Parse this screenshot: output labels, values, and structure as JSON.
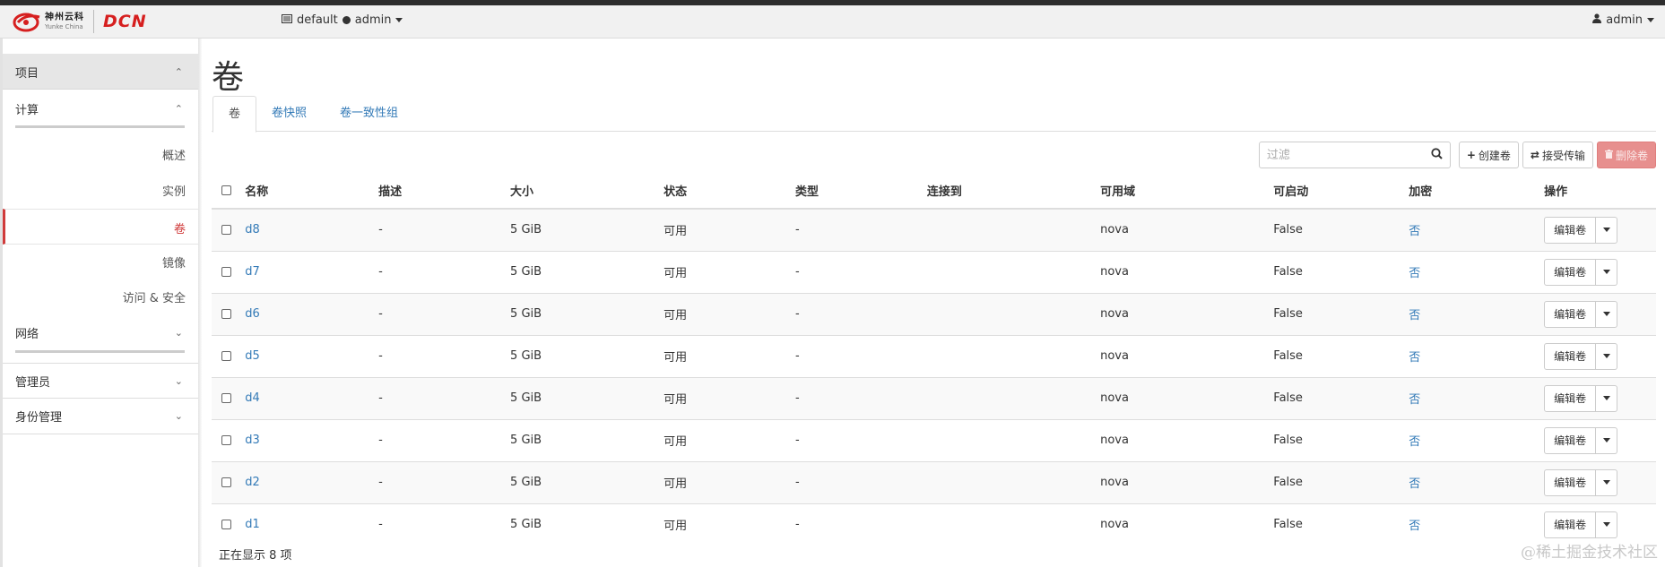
{
  "header": {
    "logo_cn": "神州云科",
    "logo_en": "Yunke China",
    "logo_brand": "DCN",
    "project": "default",
    "project_user": "admin",
    "user": "admin"
  },
  "sidebar": {
    "project": "项目",
    "compute": "计算",
    "compute_items": [
      "概述",
      "实例",
      "卷",
      "镜像",
      "访问 & 安全"
    ],
    "network": "网络",
    "admin": "管理员",
    "identity": "身份管理"
  },
  "main": {
    "title": "卷",
    "tabs": [
      "卷",
      "卷快照",
      "卷一致性组"
    ],
    "filter_placeholder": "过滤",
    "btn_create": "创建卷",
    "btn_transfer": "接受传输",
    "btn_delete": "删除卷",
    "columns": [
      "名称",
      "描述",
      "大小",
      "状态",
      "类型",
      "连接到",
      "可用域",
      "可启动",
      "加密",
      "操作"
    ],
    "rows": [
      {
        "name": "d8",
        "desc": "-",
        "size": "5 GiB",
        "status": "可用",
        "type": "-",
        "attached": "",
        "zone": "nova",
        "bootable": "False",
        "encrypted": "否",
        "action": "编辑卷"
      },
      {
        "name": "d7",
        "desc": "-",
        "size": "5 GiB",
        "status": "可用",
        "type": "-",
        "attached": "",
        "zone": "nova",
        "bootable": "False",
        "encrypted": "否",
        "action": "编辑卷"
      },
      {
        "name": "d6",
        "desc": "-",
        "size": "5 GiB",
        "status": "可用",
        "type": "-",
        "attached": "",
        "zone": "nova",
        "bootable": "False",
        "encrypted": "否",
        "action": "编辑卷"
      },
      {
        "name": "d5",
        "desc": "-",
        "size": "5 GiB",
        "status": "可用",
        "type": "-",
        "attached": "",
        "zone": "nova",
        "bootable": "False",
        "encrypted": "否",
        "action": "编辑卷"
      },
      {
        "name": "d4",
        "desc": "-",
        "size": "5 GiB",
        "status": "可用",
        "type": "-",
        "attached": "",
        "zone": "nova",
        "bootable": "False",
        "encrypted": "否",
        "action": "编辑卷"
      },
      {
        "name": "d3",
        "desc": "-",
        "size": "5 GiB",
        "status": "可用",
        "type": "-",
        "attached": "",
        "zone": "nova",
        "bootable": "False",
        "encrypted": "否",
        "action": "编辑卷"
      },
      {
        "name": "d2",
        "desc": "-",
        "size": "5 GiB",
        "status": "可用",
        "type": "-",
        "attached": "",
        "zone": "nova",
        "bootable": "False",
        "encrypted": "否",
        "action": "编辑卷"
      },
      {
        "name": "d1",
        "desc": "-",
        "size": "5 GiB",
        "status": "可用",
        "type": "-",
        "attached": "",
        "zone": "nova",
        "bootable": "False",
        "encrypted": "否",
        "action": "编辑卷"
      }
    ],
    "footer": "正在显示 8 项"
  },
  "watermark": "@稀土掘金技术社区"
}
